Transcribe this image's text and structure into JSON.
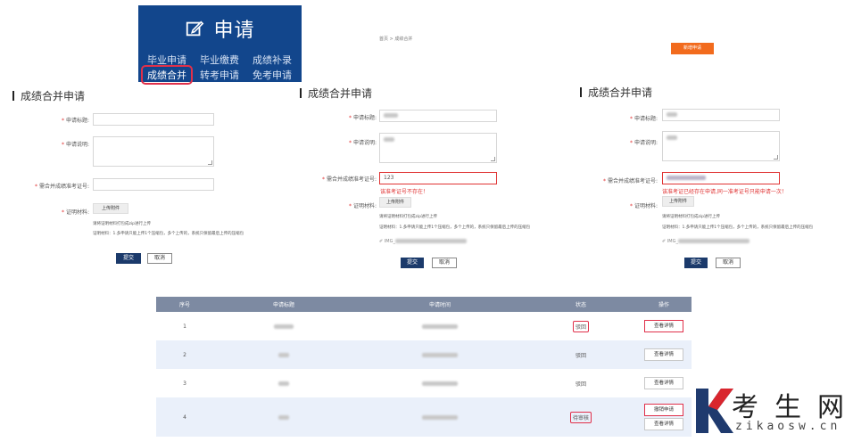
{
  "menu": {
    "title": "申请",
    "row1": [
      "毕业申请",
      "毕业缴费",
      "成绩补录"
    ],
    "row2": [
      "成绩合并",
      "转考申请",
      "免考申请"
    ],
    "active_item": "成绩合并"
  },
  "breadcrumb": "首页 > 成绩合并",
  "apply_button": "新增申请",
  "forms": [
    {
      "title": "成绩合并申请",
      "labels": {
        "title": "申请标题:",
        "desc": "申请说明:",
        "ticket": "需合并成绩准考证号:",
        "material": "证明材料:"
      },
      "values": {
        "title": "",
        "desc": "",
        "ticket": ""
      },
      "error": "",
      "upload": "上传附件",
      "hint1": "请将证明材料打包成zip进行上传",
      "hint2": "证明材料：1.多申请只能上传1个压缩包，多个上传的，系统只保留最后上传的压缩包",
      "file": "",
      "submit": "提交",
      "cancel": "取消"
    },
    {
      "title": "成绩合并申请",
      "labels": {
        "title": "申请标题:",
        "desc": "申请说明:",
        "ticket": "需合并成绩准考证号:",
        "material": "证明材料:"
      },
      "values": {
        "title": "",
        "desc": "",
        "ticket": "123"
      },
      "error": "该准考证号不存在！",
      "upload": "上传附件",
      "hint1": "请将证明材料打包成zip进行上传",
      "hint2": "证明材料：1.多申请只能上传1个压缩包，多个上传的，系统只保留最后上传的压缩包",
      "file": "IMG_",
      "submit": "提交",
      "cancel": "取消"
    },
    {
      "title": "成绩合并申请",
      "labels": {
        "title": "申请标题:",
        "desc": "申请说明:",
        "ticket": "需合并成绩准考证号:",
        "material": "证明材料:"
      },
      "values": {
        "title": "",
        "desc": "",
        "ticket": ""
      },
      "error": "该准考证已经存在申请,同一准考证号只能申请一次！",
      "upload": "上传附件",
      "hint1": "请将证明材料打包成zip进行上传",
      "hint2": "证明材料：1.多申请只能上传1个压缩包，多个上传的，系统只保留最后上传的压缩包",
      "file": "IMG_",
      "submit": "提交",
      "cancel": "取消"
    }
  ],
  "table": {
    "headers": [
      "序号",
      "申请标题",
      "申请时间",
      "状态",
      "操作"
    ],
    "rows": [
      {
        "no": "1",
        "status": "驳回",
        "actions": [
          "查看详情"
        ]
      },
      {
        "no": "2",
        "status": "驳回",
        "actions": [
          "查看详情"
        ]
      },
      {
        "no": "3",
        "status": "驳回",
        "actions": [
          "查看详情"
        ]
      },
      {
        "no": "4",
        "status": "待审核",
        "actions": [
          "撤销申请",
          "查看详情"
        ]
      }
    ]
  },
  "logo": {
    "cn": "考生网",
    "en": "zikaosw.cn",
    "colors": {
      "k_main": "#1f3a6e",
      "k_accent": "#d9262e"
    }
  },
  "colors": {
    "menu_bg": "#12468c",
    "accent_red": "#e0304a",
    "table_header": "#7d8aa2",
    "row_alt": "#eaf0fa",
    "apply_btn": "#f26b1d",
    "submit_btn": "#1b3a6b"
  }
}
